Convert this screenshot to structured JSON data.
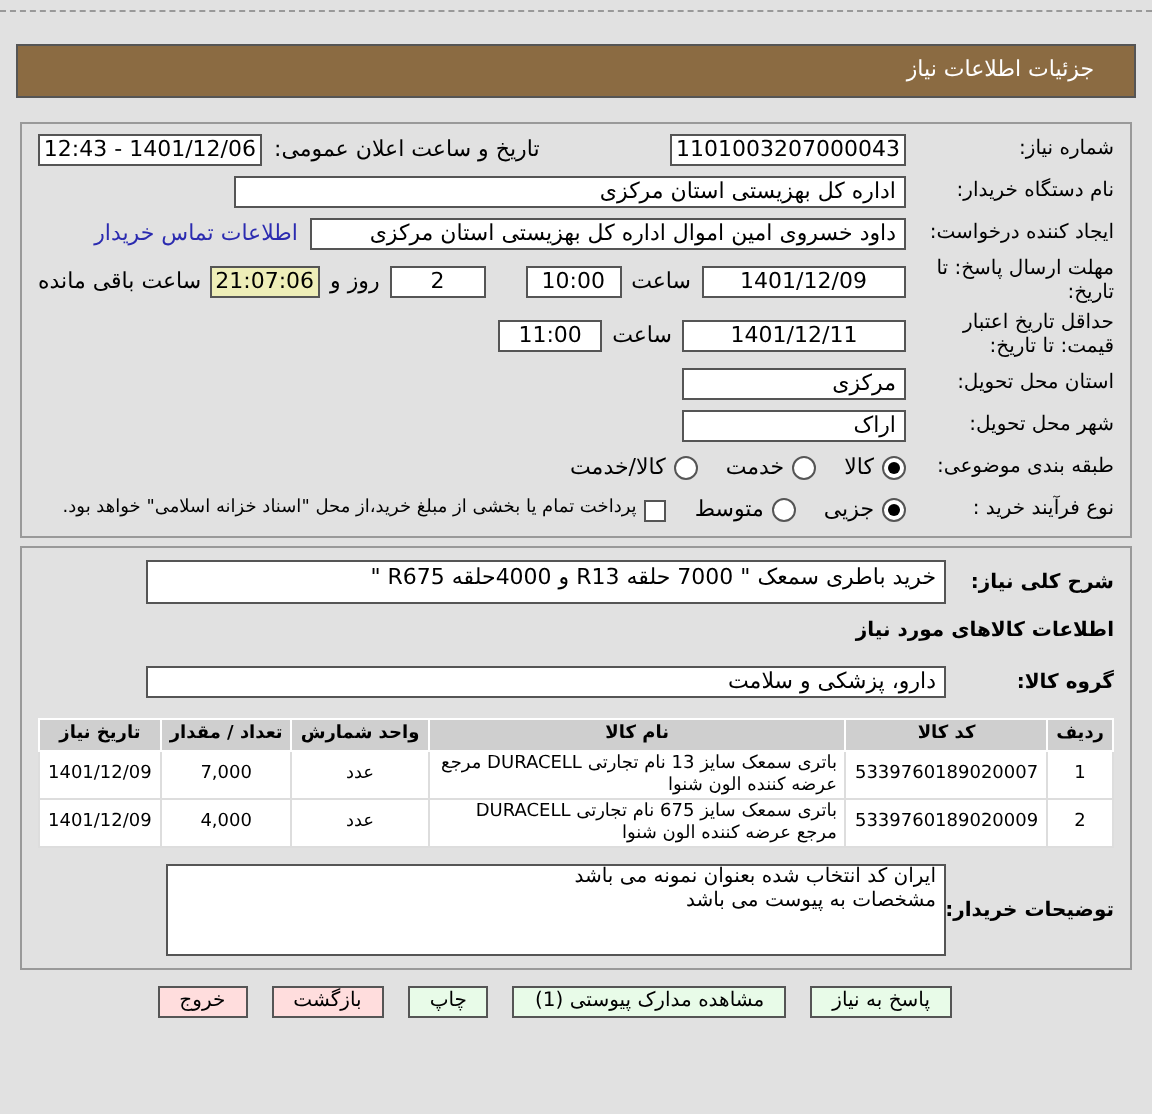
{
  "header": {
    "title": "جزئیات اطلاعات نیاز"
  },
  "need_number": {
    "label": "شماره نیاز:",
    "value": "1101003207000043"
  },
  "announce": {
    "label": "تاریخ و ساعت اعلان عمومی:",
    "value": "1401/12/06 - 12:43"
  },
  "buyer": {
    "label": "نام دستگاه خریدار:",
    "value": "اداره کل بهزیستی استان مرکزی"
  },
  "creator": {
    "label": "ایجاد کننده درخواست:",
    "value": "داود خسروی امین اموال اداره کل بهزیستی استان مرکزی",
    "link": "اطلاعات تماس خریدار"
  },
  "deadline": {
    "label": "مهلت ارسال پاسخ: تا تاریخ:",
    "date": "1401/12/09",
    "time_label": "ساعت",
    "time": "10:00",
    "days": "2",
    "days_label": "روز و",
    "remaining": "21:07:06",
    "remaining_label": "ساعت باقی مانده"
  },
  "validity": {
    "label": "حداقل تاریخ اعتبار قیمت: تا تاریخ:",
    "date": "1401/12/11",
    "time_label": "ساعت",
    "time": "11:00"
  },
  "province": {
    "label": "استان محل تحویل:",
    "value": "مرکزی"
  },
  "city": {
    "label": "شهر محل تحویل:",
    "value": "اراک"
  },
  "category": {
    "label": "طبقه بندی موضوعی:",
    "options": [
      {
        "label": "کالا",
        "selected": true
      },
      {
        "label": "خدمت",
        "selected": false
      },
      {
        "label": "کالا/خدمت",
        "selected": false
      }
    ]
  },
  "purchase": {
    "label": "نوع فرآیند خرید :",
    "options": [
      {
        "label": "جزیی",
        "selected": true
      },
      {
        "label": "متوسط",
        "selected": false
      }
    ],
    "payment": {
      "label": "پرداخت تمام یا بخشی از مبلغ خرید،از محل \"اسناد خزانه اسلامی\" خواهد بود.",
      "checked": false
    }
  },
  "summary": {
    "label": "شرح کلی نیاز:",
    "value": "خرید باطری سمعک \" 7000 حلقه R13  و  4000حلقه R675 \""
  },
  "goods_heading": "اطلاعات کالاهای مورد نیاز",
  "goods_group": {
    "label": "گروه کالا:",
    "value": "دارو، پزشکی و سلامت"
  },
  "table": {
    "columns": [
      "ردیف",
      "کد کالا",
      "نام کالا",
      "واحد شمارش",
      "تعداد / مقدار",
      "تاریخ نیاز"
    ],
    "rows": [
      [
        "1",
        "5339760189020007",
        "باتری سمعک سایز 13 نام تجارتی DURACELL مرجع عرضه کننده الون شنوا",
        "عدد",
        "7,000",
        "1401/12/09"
      ],
      [
        "2",
        "5339760189020009",
        "باتری سمعک سایز 675 نام تجارتی DURACELL مرجع عرضه کننده الون شنوا",
        "عدد",
        "4,000",
        "1401/12/09"
      ]
    ]
  },
  "notes": {
    "label": "توضیحات خریدار:",
    "lines": [
      "ایران کد انتخاب شده بعنوان نمونه می باشد",
      "مشخصات به پیوست می باشد"
    ]
  },
  "buttons": [
    {
      "label": "پاسخ به نیاز",
      "kind": "green"
    },
    {
      "label": "مشاهده مدارک پیوستی (1)",
      "kind": "green"
    },
    {
      "label": "چاپ",
      "kind": "green"
    },
    {
      "label": "بازگشت",
      "kind": "red"
    },
    {
      "label": "خروج",
      "kind": "red"
    }
  ]
}
